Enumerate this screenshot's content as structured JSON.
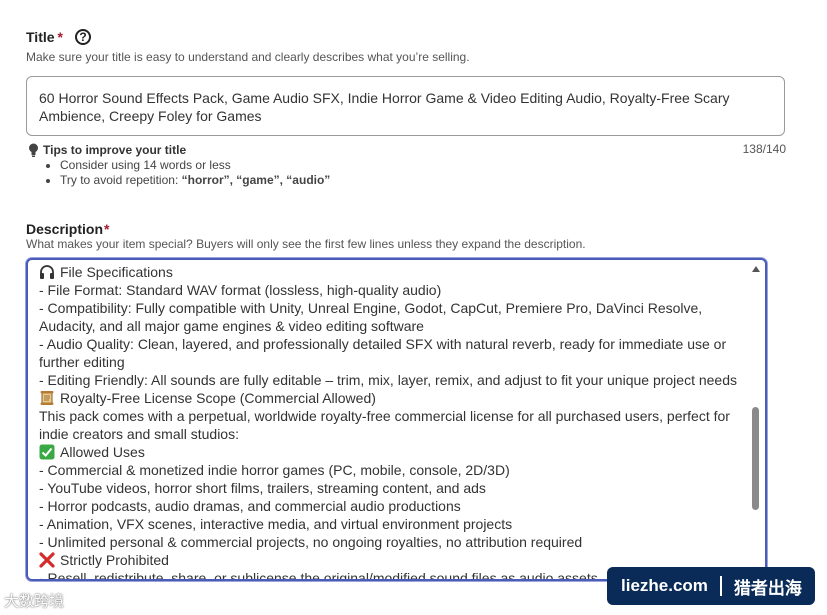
{
  "title_field": {
    "label": "Title",
    "required_mark": "*",
    "help_glyph": "?",
    "hint": "Make sure your title is easy to understand and clearly describes what you’re selling.",
    "value_line1": "60 Horror Sound Effects Pack, Game Audio SFX, Indie Horror Game & Video Editing Audio, Royalty-Free Scary",
    "value_line2": "Ambience, Creepy Foley for Games",
    "char_count": "138/140",
    "tips": {
      "heading": "Tips to improve your title",
      "icon": "lightbulb-icon",
      "items": [
        {
          "text": "Consider using 14 words or less"
        },
        {
          "prefix": "Try to avoid repetition: ",
          "bold": "“horror”, “game”, “audio”"
        }
      ]
    }
  },
  "description_field": {
    "label": "Description",
    "required_mark": "*",
    "hint": "What makes your item special? Buyers will only see the first few lines unless they expand the description.",
    "lines": [
      {
        "icon": "headphones-icon",
        "text": "File Specifications"
      },
      {
        "text": "- File Format: Standard WAV format (lossless, high-quality audio)"
      },
      {
        "text": "- Compatibility: Fully compatible with Unity, Unreal Engine, Godot, CapCut, Premiere Pro, DaVinci Resolve,"
      },
      {
        "text": "Audacity, and all major game engines & video editing software"
      },
      {
        "text": "- Audio Quality: Clean, layered, and professionally detailed SFX with natural reverb, ready for immediate use or"
      },
      {
        "text": "further editing"
      },
      {
        "text": "- Editing Friendly: All sounds are fully editable – trim, mix, layer, remix, and adjust to fit your unique project needs"
      },
      {
        "icon": "scroll-icon",
        "text": "Royalty-Free License Scope (Commercial Allowed)"
      },
      {
        "text": "This pack comes with a perpetual, worldwide royalty-free commercial license for all purchased users, perfect for"
      },
      {
        "text": "indie creators and small studios:"
      },
      {
        "icon": "check-mark-icon",
        "text": "Allowed Uses"
      },
      {
        "text": "- Commercial & monetized indie horror games (PC, mobile, console, 2D/3D)"
      },
      {
        "text": "- YouTube videos, horror short films, trailers, streaming content, and ads"
      },
      {
        "text": "- Horror podcasts, audio dramas, and commercial audio productions"
      },
      {
        "text": "- Animation, VFX scenes, interactive media, and virtual environment projects"
      },
      {
        "text": "- Unlimited personal & commercial projects, no ongoing royalties, no attribution required"
      },
      {
        "icon": "cross-mark-icon",
        "text": "Strictly Prohibited"
      },
      {
        "text": "- Resell, redistribute, share, or sublicense the original/modified sound files as audio assets"
      }
    ],
    "scroll_position": 0.55
  },
  "badge": {
    "site": "liezhe.com",
    "tagline": "猎者出海"
  },
  "watermark": "大数跨境",
  "colors": {
    "required": "#a61a2e",
    "focus_border": "#4a5bb8",
    "badge_bg": "#0a2a57",
    "text": "#222222"
  }
}
